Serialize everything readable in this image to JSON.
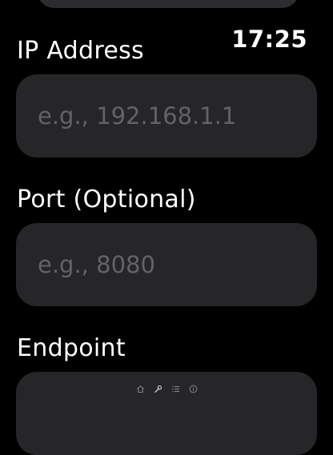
{
  "status_bar": {
    "time": "17:25"
  },
  "form": {
    "ip_address": {
      "label": "IP Address",
      "value": "",
      "placeholder": "e.g., 192.168.1.1"
    },
    "port": {
      "label": "Port (Optional)",
      "value": "",
      "placeholder": "e.g., 8080"
    },
    "endpoint": {
      "label": "Endpoint"
    }
  },
  "page_indicator": {
    "pages": [
      "home-icon",
      "wrench-icon",
      "list-icon",
      "info-icon"
    ],
    "current_index": 1
  },
  "colors": {
    "background": "#000000",
    "field_background": "#262628",
    "placeholder": "#636366",
    "text": "#ffffff"
  }
}
